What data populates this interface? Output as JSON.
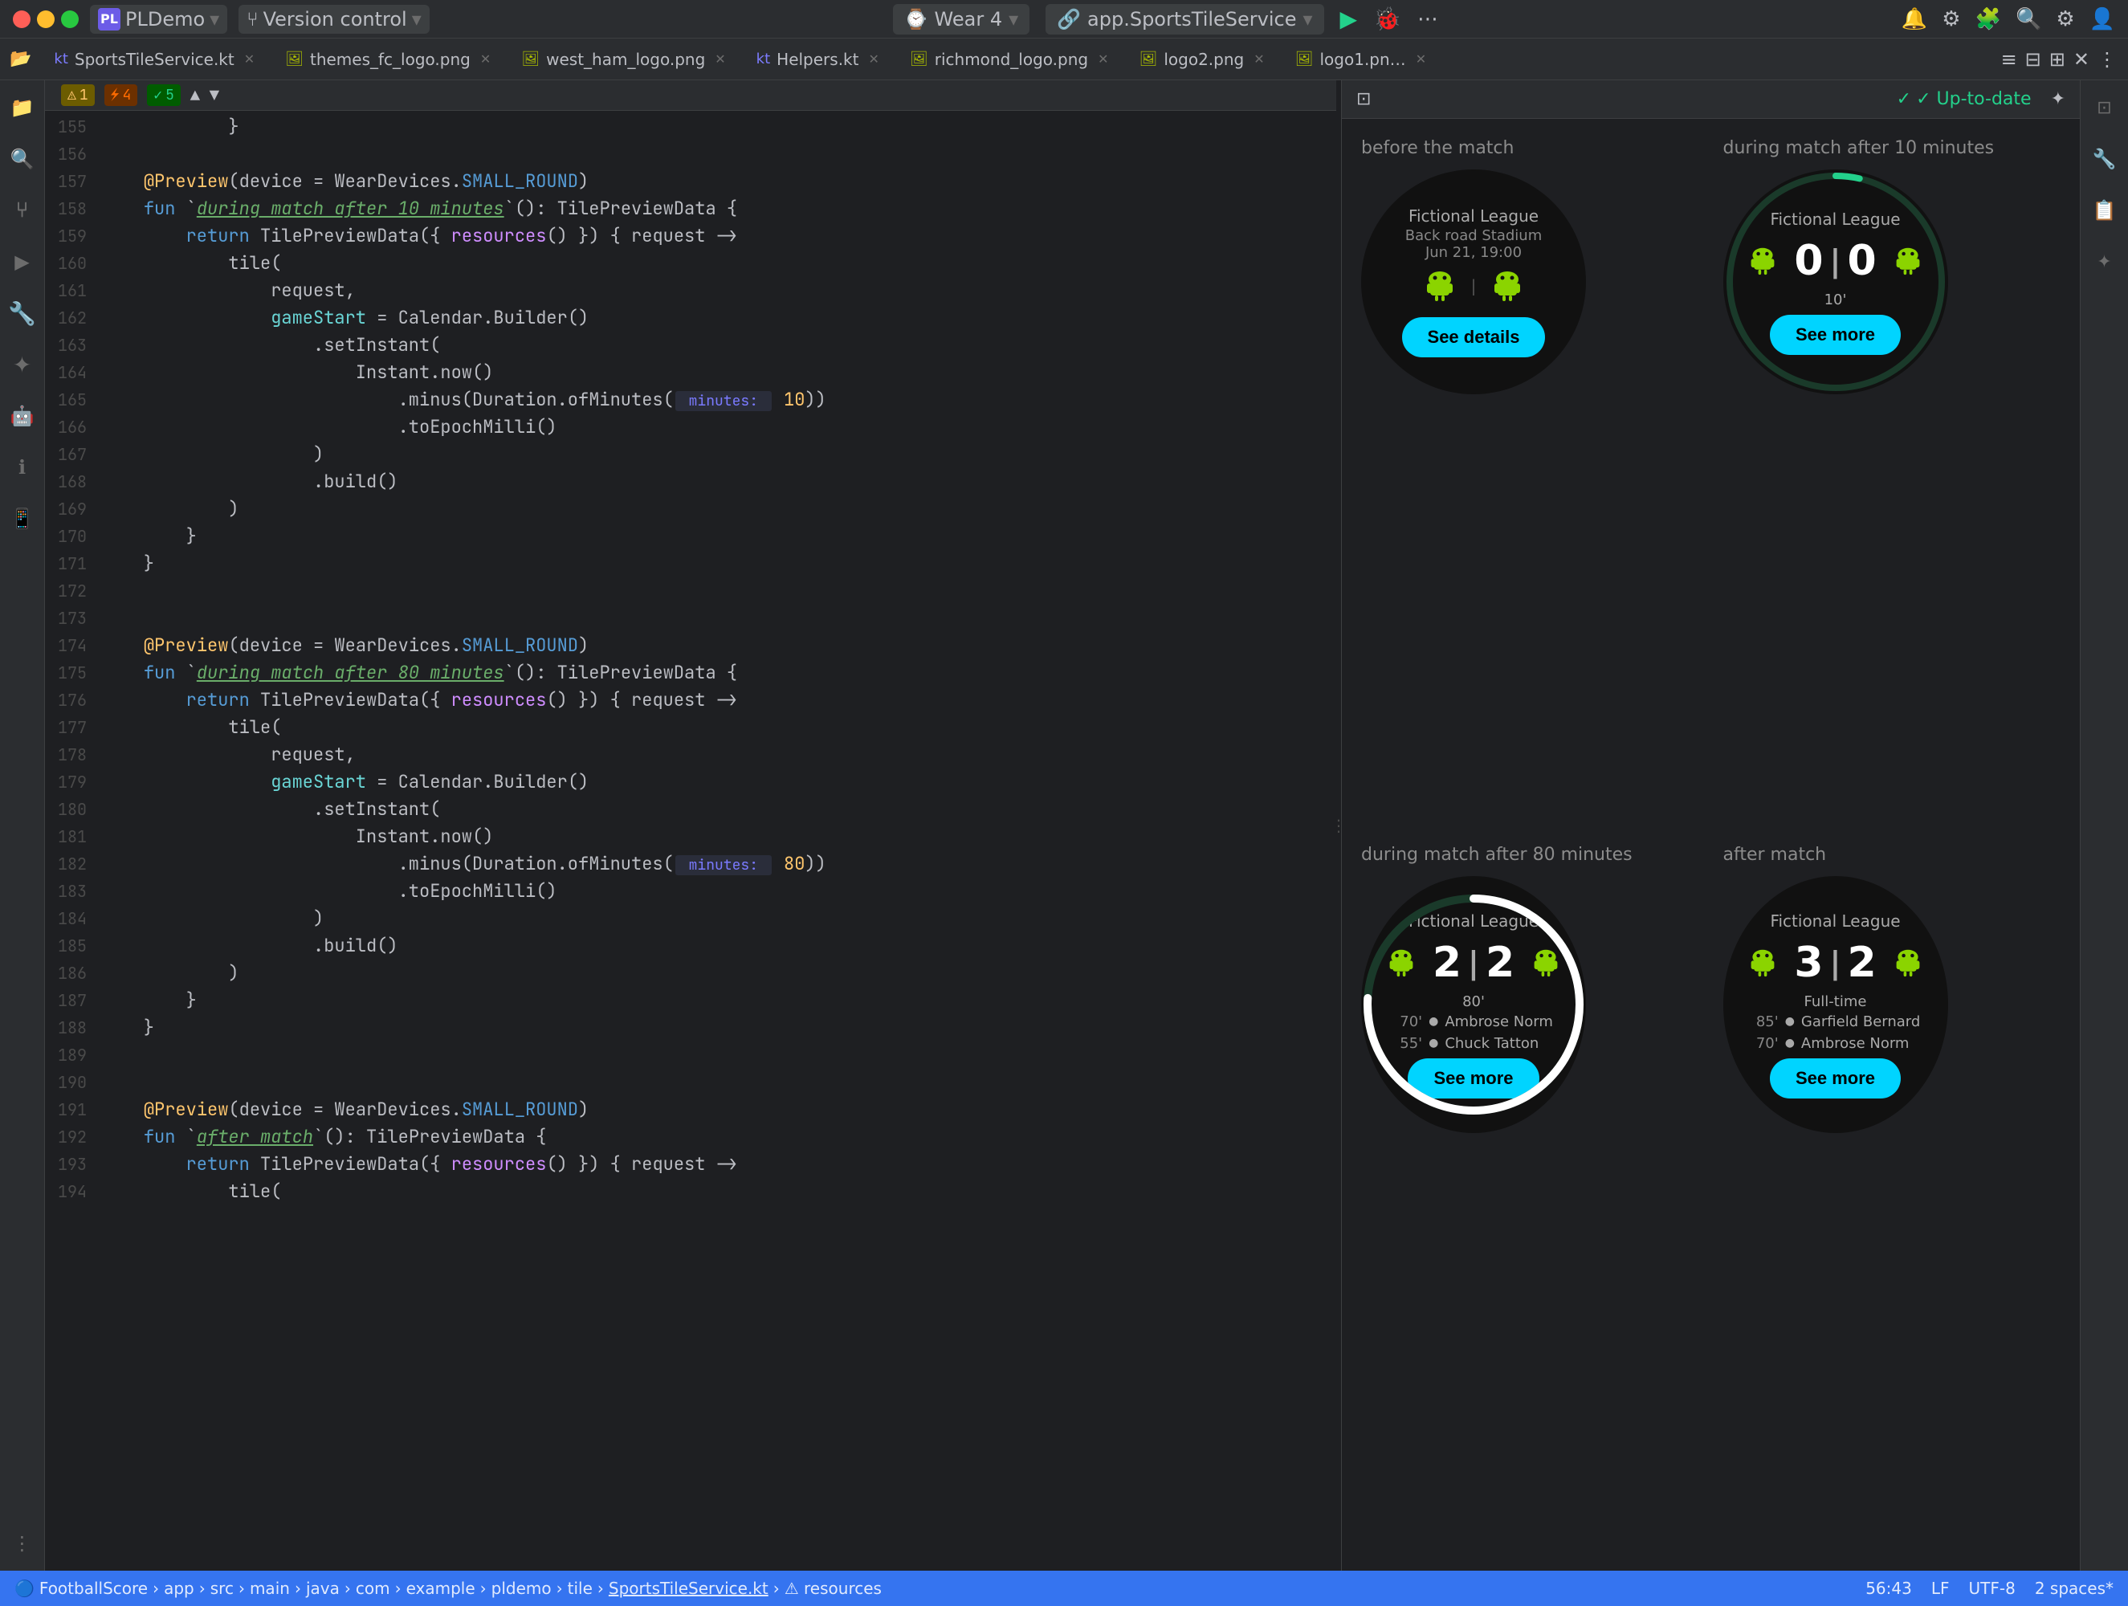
{
  "titlebar": {
    "traffic_lights": [
      "red",
      "yellow",
      "green"
    ],
    "project": "PLDemo",
    "vcs": "Version control",
    "wear": "Wear 4",
    "service": "app.SportsTileService",
    "run_icon": "▶",
    "debug_icon": "🐞",
    "more_icon": "⋯",
    "search_icon": "🔍",
    "settings_icon": "⚙",
    "user_icon": "👤"
  },
  "tabs": [
    {
      "id": "sports-tile",
      "label": "SportsTileService.kt",
      "active": true,
      "icon": "kt"
    },
    {
      "id": "themes-logo",
      "label": "themes_fc_logo.png",
      "active": false,
      "icon": "img"
    },
    {
      "id": "west-ham",
      "label": "west_ham_logo.png",
      "active": false,
      "icon": "img"
    },
    {
      "id": "helpers",
      "label": "Helpers.kt",
      "active": false,
      "icon": "kt"
    },
    {
      "id": "richmond-logo",
      "label": "richmond_logo.png",
      "active": false,
      "icon": "img"
    },
    {
      "id": "logo2",
      "label": "logo2.png",
      "active": false,
      "icon": "img"
    },
    {
      "id": "logo1",
      "label": "logo1.pn…",
      "active": false,
      "icon": "img"
    }
  ],
  "editor": {
    "warnings": {
      "yellow": "1",
      "orange": "4",
      "green": "5"
    },
    "lines": [
      {
        "num": 155,
        "tokens": [
          {
            "text": "            }",
            "cls": ""
          }
        ]
      },
      {
        "num": 156,
        "tokens": [
          {
            "text": "",
            "cls": ""
          }
        ]
      },
      {
        "num": 157,
        "tokens": [
          {
            "text": "    ",
            "cls": ""
          },
          {
            "text": "@Preview",
            "cls": "annotation"
          },
          {
            "text": "(device = WearDevices.",
            "cls": ""
          },
          {
            "text": "SMALL_ROUND",
            "cls": "kw-blue"
          },
          {
            "text": ")",
            "cls": ""
          }
        ]
      },
      {
        "num": 158,
        "tokens": [
          {
            "text": "    ",
            "cls": ""
          },
          {
            "text": "fun",
            "cls": "kw-blue"
          },
          {
            "text": " `",
            "cls": ""
          },
          {
            "text": "during match after 10 minutes",
            "cls": "func-name"
          },
          {
            "text": "`(): TilePreviewData {",
            "cls": ""
          }
        ]
      },
      {
        "num": 159,
        "tokens": [
          {
            "text": "        ",
            "cls": ""
          },
          {
            "text": "return",
            "cls": "kw-blue"
          },
          {
            "text": " TilePreviewData({ ",
            "cls": ""
          },
          {
            "text": "resources",
            "cls": "kw-purple"
          },
          {
            "text": "() }) { request ->",
            "cls": ""
          }
        ]
      },
      {
        "num": 160,
        "tokens": [
          {
            "text": "            tile(",
            "cls": ""
          }
        ]
      },
      {
        "num": 161,
        "tokens": [
          {
            "text": "                request,",
            "cls": ""
          }
        ]
      },
      {
        "num": 162,
        "tokens": [
          {
            "text": "                ",
            "cls": ""
          },
          {
            "text": "gameStart",
            "cls": "kw-cyan"
          },
          {
            "text": " = Calendar.Builder()",
            "cls": ""
          }
        ]
      },
      {
        "num": 163,
        "tokens": [
          {
            "text": "                    .setInstant(",
            "cls": ""
          }
        ]
      },
      {
        "num": 164,
        "tokens": [
          {
            "text": "                        Instant.now()",
            "cls": ""
          }
        ]
      },
      {
        "num": 165,
        "tokens": [
          {
            "text": "                            .minus(Duration.ofMinutes(",
            "cls": ""
          },
          {
            "text": " minutes: ",
            "cls": "param-hint"
          },
          {
            "text": " 10",
            "cls": "kw-yellow"
          },
          {
            "text": "))",
            "cls": ""
          }
        ]
      },
      {
        "num": 166,
        "tokens": [
          {
            "text": "                            .toEpochMilli()",
            "cls": ""
          }
        ]
      },
      {
        "num": 167,
        "tokens": [
          {
            "text": "                    )",
            "cls": ""
          }
        ]
      },
      {
        "num": 168,
        "tokens": [
          {
            "text": "                    .build()",
            "cls": ""
          }
        ]
      },
      {
        "num": 169,
        "tokens": [
          {
            "text": "            )",
            "cls": ""
          }
        ]
      },
      {
        "num": 170,
        "tokens": [
          {
            "text": "        }",
            "cls": ""
          }
        ]
      },
      {
        "num": 171,
        "tokens": [
          {
            "text": "    }",
            "cls": ""
          }
        ]
      },
      {
        "num": 172,
        "tokens": [
          {
            "text": "",
            "cls": ""
          }
        ]
      },
      {
        "num": 173,
        "tokens": [
          {
            "text": "",
            "cls": ""
          }
        ]
      },
      {
        "num": 174,
        "tokens": [
          {
            "text": "    ",
            "cls": ""
          },
          {
            "text": "@Preview",
            "cls": "annotation"
          },
          {
            "text": "(device = WearDevices.",
            "cls": ""
          },
          {
            "text": "SMALL_ROUND",
            "cls": "kw-blue"
          },
          {
            "text": ")",
            "cls": ""
          }
        ]
      },
      {
        "num": 175,
        "tokens": [
          {
            "text": "    ",
            "cls": ""
          },
          {
            "text": "fun",
            "cls": "kw-blue"
          },
          {
            "text": " `",
            "cls": ""
          },
          {
            "text": "during match after 80 minutes",
            "cls": "func-name"
          },
          {
            "text": "`(): TilePreviewData {",
            "cls": ""
          }
        ]
      },
      {
        "num": 176,
        "tokens": [
          {
            "text": "        ",
            "cls": ""
          },
          {
            "text": "return",
            "cls": "kw-blue"
          },
          {
            "text": " TilePreviewData({ ",
            "cls": ""
          },
          {
            "text": "resources",
            "cls": "kw-purple"
          },
          {
            "text": "() }) { request ->",
            "cls": ""
          }
        ]
      },
      {
        "num": 177,
        "tokens": [
          {
            "text": "            tile(",
            "cls": ""
          }
        ]
      },
      {
        "num": 178,
        "tokens": [
          {
            "text": "                request,",
            "cls": ""
          }
        ]
      },
      {
        "num": 179,
        "tokens": [
          {
            "text": "                ",
            "cls": ""
          },
          {
            "text": "gameStart",
            "cls": "kw-cyan"
          },
          {
            "text": " = Calendar.Builder()",
            "cls": ""
          }
        ]
      },
      {
        "num": 180,
        "tokens": [
          {
            "text": "                    .setInstant(",
            "cls": ""
          }
        ]
      },
      {
        "num": 181,
        "tokens": [
          {
            "text": "                        Instant.now()",
            "cls": ""
          }
        ]
      },
      {
        "num": 182,
        "tokens": [
          {
            "text": "                            .minus(Duration.ofMinutes(",
            "cls": ""
          },
          {
            "text": " minutes: ",
            "cls": "param-hint"
          },
          {
            "text": " 80",
            "cls": "kw-yellow"
          },
          {
            "text": "))",
            "cls": ""
          }
        ]
      },
      {
        "num": 183,
        "tokens": [
          {
            "text": "                            .toEpochMilli()",
            "cls": ""
          }
        ]
      },
      {
        "num": 184,
        "tokens": [
          {
            "text": "                    )",
            "cls": ""
          }
        ]
      },
      {
        "num": 185,
        "tokens": [
          {
            "text": "                    .build()",
            "cls": ""
          }
        ]
      },
      {
        "num": 186,
        "tokens": [
          {
            "text": "            )",
            "cls": ""
          }
        ]
      },
      {
        "num": 187,
        "tokens": [
          {
            "text": "        }",
            "cls": ""
          }
        ]
      },
      {
        "num": 188,
        "tokens": [
          {
            "text": "    }",
            "cls": ""
          }
        ]
      },
      {
        "num": 189,
        "tokens": [
          {
            "text": "",
            "cls": ""
          }
        ]
      },
      {
        "num": 190,
        "tokens": [
          {
            "text": "",
            "cls": ""
          }
        ]
      },
      {
        "num": 191,
        "tokens": [
          {
            "text": "    ",
            "cls": ""
          },
          {
            "text": "@Preview",
            "cls": "annotation"
          },
          {
            "text": "(device = WearDevices.",
            "cls": ""
          },
          {
            "text": "SMALL_ROUND",
            "cls": "kw-blue"
          },
          {
            "text": ")",
            "cls": ""
          }
        ]
      },
      {
        "num": 192,
        "tokens": [
          {
            "text": "    ",
            "cls": ""
          },
          {
            "text": "fun",
            "cls": "kw-blue"
          },
          {
            "text": " `",
            "cls": ""
          },
          {
            "text": "after match",
            "cls": "func-name"
          },
          {
            "text": "`(): TilePreviewData {",
            "cls": ""
          }
        ]
      },
      {
        "num": 193,
        "tokens": [
          {
            "text": "        ",
            "cls": ""
          },
          {
            "text": "return",
            "cls": "kw-blue"
          },
          {
            "text": " TilePreviewData({ ",
            "cls": ""
          },
          {
            "text": "resources",
            "cls": "kw-purple"
          },
          {
            "text": "() }) { request ->",
            "cls": ""
          }
        ]
      },
      {
        "num": 194,
        "tokens": [
          {
            "text": "            tile(",
            "cls": ""
          }
        ]
      }
    ]
  },
  "preview": {
    "header": {
      "up_to_date": "✓ Up-to-date"
    },
    "cards": [
      {
        "id": "before-match",
        "label": "before the match",
        "watch": {
          "type": "before",
          "league": "Fictional League",
          "venue": "Back road Stadium",
          "date": "Jun 21, 19:00",
          "button_label": "See details"
        }
      },
      {
        "id": "during-10",
        "label": "during match after 10 minutes",
        "watch": {
          "type": "during",
          "league": "Fictional League",
          "score_home": "0",
          "score_away": "0",
          "minute": "10'",
          "button_label": "See more",
          "arc_progress": 12
        }
      },
      {
        "id": "during-80",
        "label": "during match after 80 minutes",
        "watch": {
          "type": "during-scorers",
          "league": "Fictional League",
          "score_home": "2",
          "score_away": "2",
          "minute": "80'",
          "scorers": [
            {
              "min": "70'",
              "name": "Ambrose Norm"
            },
            {
              "min": "55'",
              "name": "Chuck Tatton"
            }
          ],
          "button_label": "See more",
          "arc_progress": 90
        }
      },
      {
        "id": "after-match",
        "label": "after match",
        "watch": {
          "type": "after",
          "league": "Fictional League",
          "score_home": "3",
          "score_away": "2",
          "full_time": "Full-time",
          "scorers": [
            {
              "min": "85'",
              "name": "Garfield Bernard"
            },
            {
              "min": "70'",
              "name": "Ambrose Norm"
            }
          ],
          "button_label": "See more"
        }
      }
    ]
  },
  "statusbar": {
    "breadcrumbs": [
      "FootballScore",
      "app",
      "src",
      "main",
      "java",
      "com",
      "example",
      "pldemo",
      "tile",
      "SportsTileService.kt",
      "resources"
    ],
    "position": "56:43",
    "encoding": "LF",
    "charset": "UTF-8",
    "indent": "2 spaces*"
  },
  "sidebar_left": {
    "icons": [
      {
        "id": "file-explorer",
        "symbol": "📁",
        "active": false
      },
      {
        "id": "search",
        "symbol": "🔍",
        "active": false
      },
      {
        "id": "vcs",
        "symbol": "⑂",
        "active": false
      },
      {
        "id": "run",
        "symbol": "▶",
        "active": false
      },
      {
        "id": "plugins",
        "symbol": "🧩",
        "active": false
      },
      {
        "id": "tools",
        "symbol": "🔧",
        "active": false
      },
      {
        "id": "design",
        "symbol": "✦",
        "active": false
      },
      {
        "id": "android",
        "symbol": "🤖",
        "active": false
      },
      {
        "id": "info",
        "symbol": "ℹ",
        "active": false
      },
      {
        "id": "device",
        "symbol": "📱",
        "active": false
      },
      {
        "id": "more",
        "symbol": "⋮",
        "active": false
      }
    ]
  }
}
